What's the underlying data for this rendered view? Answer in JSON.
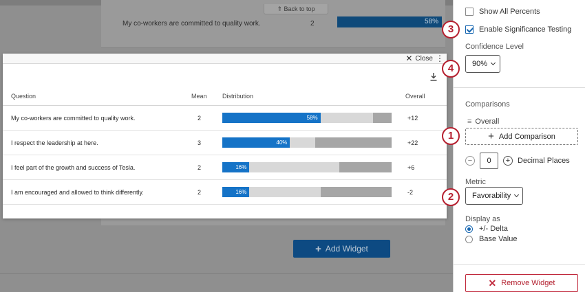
{
  "background": {
    "back_to_top": "⇑ Back to top",
    "row_label": "My co-workers are committed to quality work.",
    "row_mean": "2",
    "row_percent": "58%",
    "add_widget_label": "Add Widget"
  },
  "modal": {
    "close_label": "Close",
    "columns": {
      "question": "Question",
      "mean": "Mean",
      "distribution": "Distribution",
      "overall": "Overall"
    },
    "rows": [
      {
        "question": "My co-workers are committed to quality work.",
        "mean": "2",
        "fav_pct": 58,
        "fav_label": "58%",
        "neutral_pct": 31,
        "unfav_pct": 11,
        "overall": "+12"
      },
      {
        "question": "I respect the leadership at here.",
        "mean": "3",
        "fav_pct": 40,
        "fav_label": "40%",
        "neutral_pct": 15,
        "unfav_pct": 45,
        "overall": "+22"
      },
      {
        "question": "I feel part of the growth and success of Tesla.",
        "mean": "2",
        "fav_pct": 16,
        "fav_label": "16%",
        "neutral_pct": 53,
        "unfav_pct": 31,
        "overall": "+6"
      },
      {
        "question": "I am encouraged and allowed to think differently.",
        "mean": "2",
        "fav_pct": 16,
        "fav_label": "16%",
        "neutral_pct": 42,
        "unfav_pct": 42,
        "overall": "-2"
      }
    ]
  },
  "panel": {
    "show_all_percents": "Show All Percents",
    "enable_significance": "Enable Significance Testing",
    "confidence_level_label": "Confidence Level",
    "confidence_value": "90%",
    "comparisons_label": "Comparisons",
    "overall_item": "Overall",
    "add_comparison": "Add Comparison",
    "decimal_value": "0",
    "decimal_places": "Decimal Places",
    "metric_label": "Metric",
    "metric_value": "Favorability",
    "display_as_label": "Display as",
    "delta_option": "+/- Delta",
    "base_value_option": "Base Value",
    "remove_widget": "Remove Widget"
  },
  "callouts": [
    "1",
    "2",
    "3",
    "4"
  ],
  "colors": {
    "favorable": "#1573c7",
    "neutral": "#d8d8d8",
    "unfavorable": "#a6a6a6",
    "accent_red": "#b51f2f",
    "check_blue": "#1565b0"
  }
}
